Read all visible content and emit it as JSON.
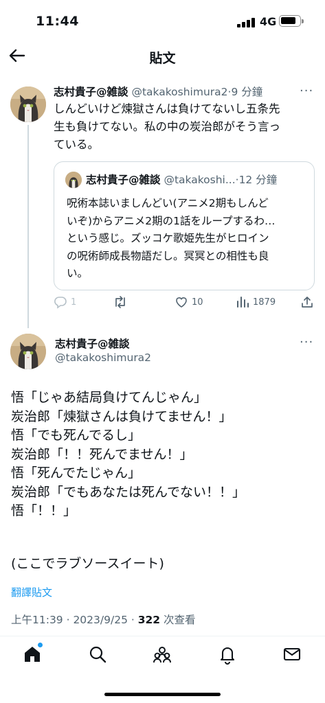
{
  "status_bar": {
    "time": "11:44",
    "network": "4G"
  },
  "header": {
    "title": "貼文"
  },
  "reply_tweet": {
    "name": "志村貴子@雑談",
    "handle": "@takakoshimura2",
    "time": "9 分鐘",
    "lines": [
      "しんどいけど煉獄さんは負けてないし五条先",
      "生も負けてない。私の中の炭治郎がそう言っ",
      "ている。"
    ],
    "quote": {
      "name": "志村貴子@雑談",
      "handle": "@takakoshi...",
      "time": "12 分鐘",
      "lines": [
        "呪術本誌いましんどい(アニメ2期もしんど",
        "いぞ)からアニメ2期の1話をループするわ…",
        "という感じ。ズッコケ歌姫先生がヒロイン",
        "の呪術師成長物語だし。冥冥との相性も良",
        "い。"
      ]
    },
    "actions": {
      "replies": "1",
      "likes": "10",
      "views": "1879"
    }
  },
  "main_tweet": {
    "name": "志村貴子@雑談",
    "handle": "@takakoshimura2",
    "lines": [
      "悟「じゃあ結局負けてんじゃん」",
      "炭治郎「煉獄さんは負けてません！」",
      "悟「でも死んでるし」",
      "炭治郎「！！死んでません！」",
      "悟「死んでたじゃん」",
      "炭治郎「でもあなたは死んでない！！」",
      "悟「！！」",
      "",
      "(ここでラブソースイート)"
    ],
    "translate_label": "翻譯貼文",
    "timestamp": "上午11:39 · 2023/9/25 · ",
    "views_count": "322",
    "views_label": " 次查看"
  },
  "colors": {
    "accent": "#1d9bf0",
    "muted": "#536471",
    "border": "#cfd9de"
  },
  "tab_bar": {
    "items": [
      "home-icon",
      "search-icon",
      "communities-icon",
      "notifications-icon",
      "messages-icon"
    ]
  }
}
